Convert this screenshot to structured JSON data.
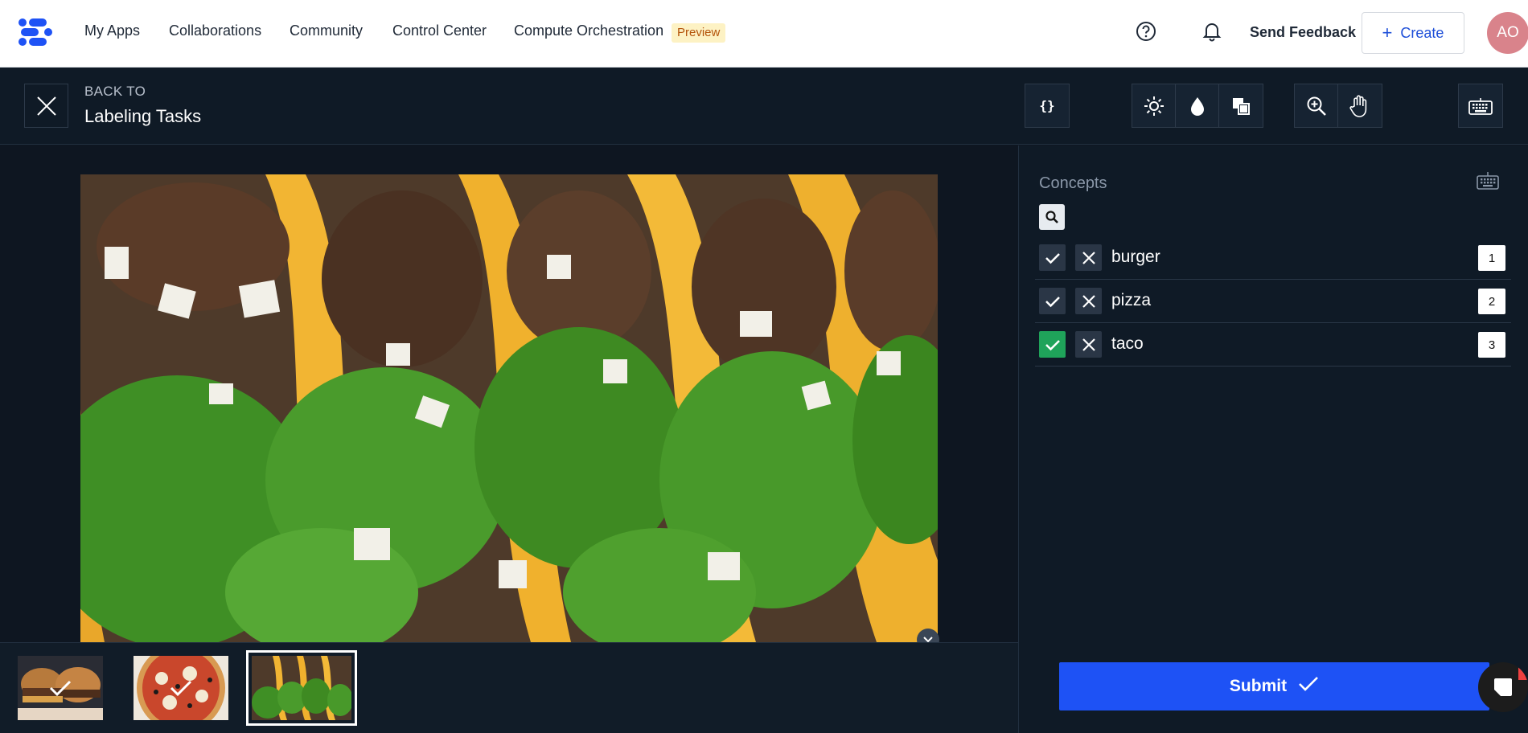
{
  "topnav": {
    "items": [
      "My Apps",
      "Collaborations",
      "Community",
      "Control Center",
      "Compute Orchestration"
    ],
    "preview_badge": "Preview",
    "send_feedback": "Send Feedback",
    "create_label": "Create",
    "avatar_initials": "AO"
  },
  "toolbar": {
    "back_to": "BACK TO",
    "title": "Labeling Tasks",
    "icons": [
      "code-icon",
      "brightness-icon",
      "contrast-icon",
      "invert-icon",
      "zoom-in-icon",
      "pan-hand-icon",
      "keyboard-icon"
    ]
  },
  "panel": {
    "title": "Concepts",
    "concepts": [
      {
        "label": "burger",
        "shortcut": "1",
        "checked": false
      },
      {
        "label": "pizza",
        "shortcut": "2",
        "checked": false
      },
      {
        "label": "taco",
        "shortcut": "3",
        "checked": true
      }
    ],
    "submit_label": "Submit"
  },
  "thumbnails": [
    {
      "name": "burger",
      "labeled": true,
      "selected": false
    },
    {
      "name": "pizza",
      "labeled": true,
      "selected": false
    },
    {
      "name": "taco",
      "labeled": false,
      "selected": true
    }
  ],
  "colors": {
    "accent": "#1e52f5",
    "checked_green": "#1fa35a",
    "background": "#0e1621",
    "preview_badge_bg": "#fdf2c4"
  }
}
